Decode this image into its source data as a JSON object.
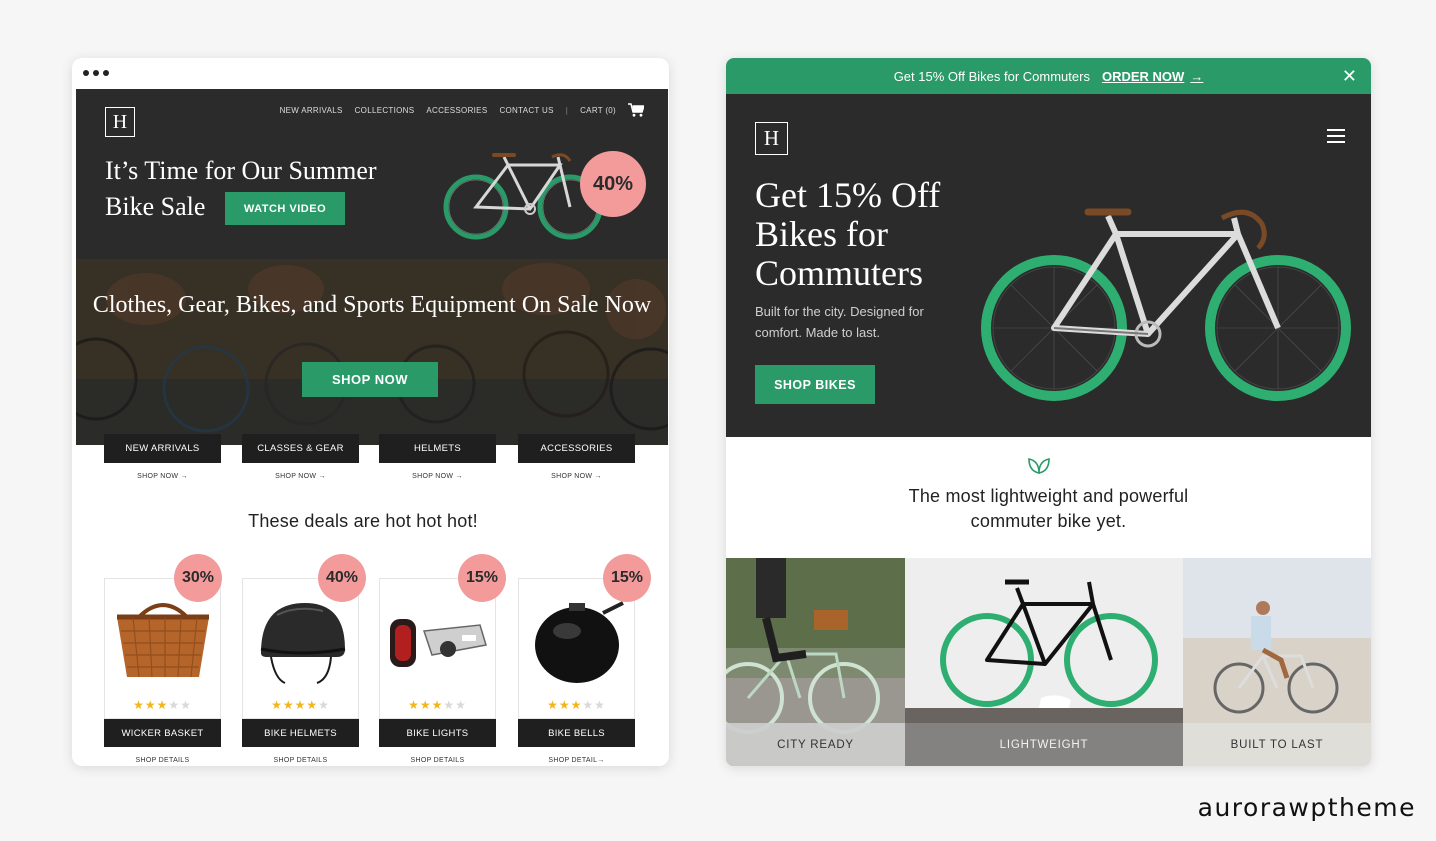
{
  "left": {
    "nav": [
      "NEW ARRIVALS",
      "COLLECTIONS",
      "ACCESSORIES",
      "CONTACT US"
    ],
    "cart": "CART (0)",
    "logo": "H",
    "hero_title": "It’s Time for Our Summer Bike Sale",
    "watch_video": "WATCH VIDEO",
    "hero_badge": "40%",
    "banner_title": "Clothes, Gear, Bikes, and Sports Equipment On Sale Now",
    "shop_now": "SHOP NOW",
    "categories": [
      {
        "label": "NEW ARRIVALS",
        "link": "SHOP NOW →"
      },
      {
        "label": "CLASSES & GEAR",
        "link": "SHOP NOW →"
      },
      {
        "label": "HELMETS",
        "link": "SHOP NOW →"
      },
      {
        "label": "ACCESSORIES",
        "link": "SHOP NOW →"
      }
    ],
    "deals_title": "These deals are hot hot hot!",
    "products": [
      {
        "name": "WICKER BASKET",
        "badge": "30%",
        "link": "SHOP DETAILS",
        "rating": 3
      },
      {
        "name": "BIKE HELMETS",
        "badge": "40%",
        "link": "SHOP DETAILS",
        "rating": 3.5
      },
      {
        "name": "BIKE LIGHTS",
        "badge": "15%",
        "link": "SHOP DETAILS",
        "rating": 3
      },
      {
        "name": "BIKE BELLS",
        "badge": "15%",
        "link": "SHOP DETAIL→",
        "rating": 3
      }
    ]
  },
  "right": {
    "promo_text": "Get 15% Off Bikes for Commuters",
    "promo_link": "ORDER NOW",
    "logo": "H",
    "hero_title": "Get 15% Off Bikes for Commuters",
    "hero_sub": "Built for the city. Designed for comfort. Made to last.",
    "shop_bikes": "SHOP BIKES",
    "tagline": "The most lightweight and powerful commuter bike yet.",
    "tiles": [
      "CITY READY",
      "LIGHTWEIGHT",
      "BUILT TO LAST"
    ]
  },
  "watermark": "aurorawptheme",
  "colors": {
    "brand_green": "#2a9a68",
    "badge_pink": "#f39b9b",
    "dark": "#2b2b2b",
    "star": "#f2b51c"
  }
}
